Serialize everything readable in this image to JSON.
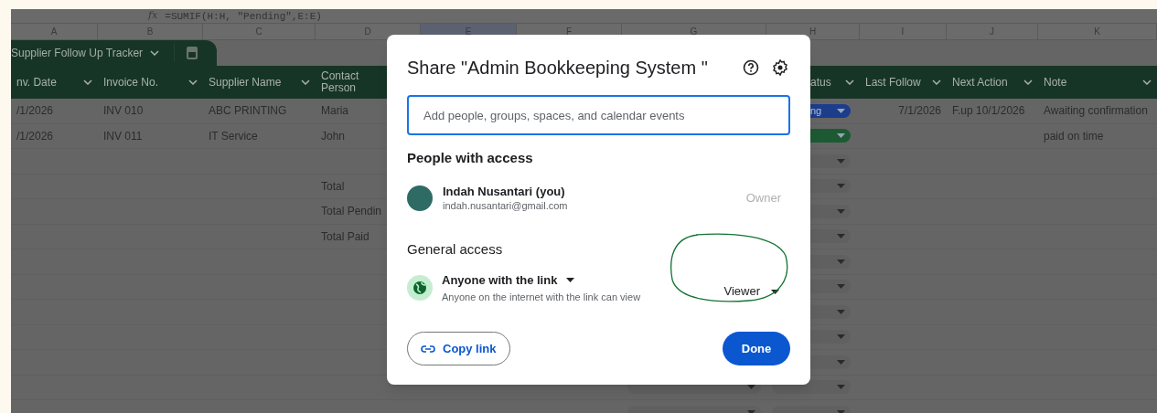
{
  "formula_bar": {
    "icon": "fx",
    "formula": "=SUMIF(H:H, \"Pending\",E:E)"
  },
  "columns": [
    {
      "letter": "A",
      "header": "nv. Date",
      "filter": true,
      "selected": false
    },
    {
      "letter": "B",
      "header": "Invoice No.",
      "filter": true,
      "selected": false
    },
    {
      "letter": "C",
      "header": "Supplier Name",
      "filter": true,
      "selected": false
    },
    {
      "letter": "D",
      "header": "Contact Person",
      "selected": false
    },
    {
      "letter": "E",
      "selected": true
    },
    {
      "letter": "F",
      "selected": false
    },
    {
      "letter": "G",
      "selected": false
    },
    {
      "letter": "H",
      "header": "atus",
      "filter": true,
      "selected": false
    },
    {
      "letter": "I",
      "header": "Last Follow",
      "filter": true,
      "selected": false
    },
    {
      "letter": "J",
      "header": "Next Action",
      "filter": true,
      "selected": false
    },
    {
      "letter": "K",
      "header": "Note",
      "filter": true,
      "selected": false
    }
  ],
  "sheet_tab": {
    "label": "Supplier Follow Up Tracker"
  },
  "rows": [
    {
      "cells": {
        "A": "/1/2026",
        "B": "INV 010",
        "C": "ABC PRINTING",
        "D": "Maria",
        "I": "7/1/2026",
        "J": "F.up 10/1/2026",
        "K": "Awaiting confirmation"
      },
      "status": {
        "text": "ng",
        "color": "#1b3d8c"
      }
    },
    {
      "cells": {
        "A": "/1/2026",
        "B": "INV 011",
        "C": "IT Service",
        "D": "John",
        "K": "paid on time"
      },
      "status": {
        "color": "#1d5a33"
      }
    },
    {
      "cells": {}
    },
    {
      "cells": {
        "D": "Total"
      }
    },
    {
      "cells": {
        "D": "Total Pendin"
      }
    },
    {
      "cells": {
        "D": "Total Paid"
      }
    },
    {
      "cells": {}
    },
    {
      "cells": {}
    },
    {
      "cells": {}
    },
    {
      "cells": {}
    },
    {
      "cells": {}
    },
    {
      "cells": {}
    },
    {
      "cells": {}
    }
  ],
  "dialog": {
    "title": "Share \"Admin Bookkeeping System \"",
    "search": {
      "placeholder": "Add people, groups, spaces, and calendar events"
    },
    "people_heading": "People with access",
    "people": [
      {
        "name": "Indah Nusantari (you)",
        "email": "indah.nusantari@gmail.com",
        "role": "Owner"
      }
    ],
    "general_heading": "General access",
    "general_access": {
      "option": "Anyone with the link",
      "description": "Anyone on the internet with the link can view",
      "role": "Viewer",
      "highlighted": true
    },
    "copy_link": "Copy link",
    "done": "Done"
  }
}
